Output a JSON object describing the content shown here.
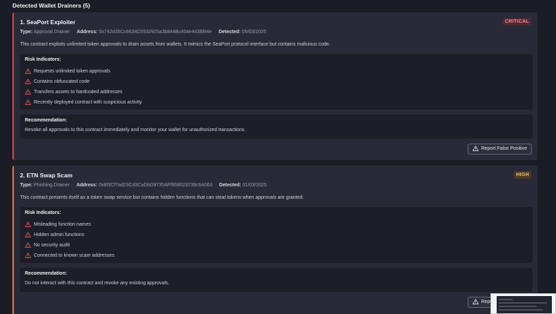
{
  "section": {
    "title": "Detected Wallet Drainers (5)"
  },
  "labels": {
    "type": "Type:",
    "address": "Address:",
    "detected": "Detected:",
    "risk_indicators": "Risk Indicators:",
    "recommendation": "Recommendation:"
  },
  "colors": {
    "critical": "#e5484d",
    "high": "#e8813a",
    "warning_icon": "#e5575c"
  },
  "cards": [
    {
      "title": "1. SeaPort Exploiter",
      "severity": "CRITICAL",
      "type": "Approval Drainer",
      "address": "0x742d35Cc6634C0532925a3b844Bc454e4438f44e",
      "detected": "05/03/2025",
      "description": "This contract exploits unlimited token approvals to drain assets from wallets. It mimics the SeaPort protocol interface but contains malicious code.",
      "risks": [
        "Requests unlimited token approvals",
        "Contains obfuscated code",
        "Transfers assets to hardcoded addresses",
        "Recently deployed contract with suspicious activity"
      ],
      "recommendation": "Revoke all approvals to this contract immediately and monitor your wallet for unauthorized transactions.",
      "report_button": "Report False Positive"
    },
    {
      "title": "2. ETN Swap Scam",
      "severity": "HIGH",
      "type": "Phishing Drainer",
      "address": "0x8f3Cf7ad23Cd3CaDbD9735AFf958023239c6A063",
      "detected": "01/03/2025",
      "description": "This contract presents itself as a token swap service but contains hidden functions that can steal tokens when approvals are granted.",
      "risks": [
        "Misleading function names",
        "Hidden admin functions",
        "No security audit",
        "Connected to known scam addresses"
      ],
      "recommendation": "Do not interact with this contract and revoke any existing approvals.",
      "report_button": "Report False Positive"
    }
  ]
}
